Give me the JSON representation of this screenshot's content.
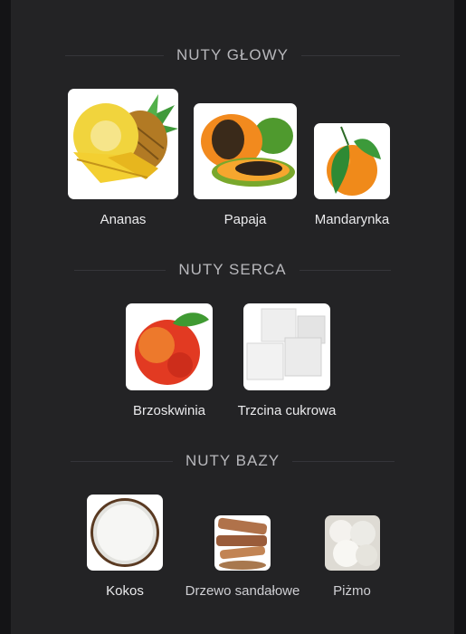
{
  "sections": [
    {
      "title": "NUTY GŁOWY",
      "notes": [
        {
          "label": "Ananas",
          "icon": "pineapple-icon"
        },
        {
          "label": "Papaja",
          "icon": "papaya-icon"
        },
        {
          "label": "Mandarynka",
          "icon": "tangerine-icon"
        }
      ]
    },
    {
      "title": "NUTY SERCA",
      "notes": [
        {
          "label": "Brzoskwinia",
          "icon": "peach-icon"
        },
        {
          "label": "Trzcina cukrowa",
          "icon": "sugar-cubes-icon"
        }
      ]
    },
    {
      "title": "NUTY BAZY",
      "notes": [
        {
          "label": "Kokos",
          "icon": "coconut-icon"
        },
        {
          "label": "Drzewo sandałowe",
          "icon": "sandalwood-icon"
        },
        {
          "label": "Piżmo",
          "icon": "musk-icon"
        }
      ]
    }
  ]
}
